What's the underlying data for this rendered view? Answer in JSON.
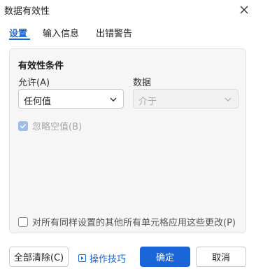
{
  "dialog": {
    "title": "数据有效性"
  },
  "tabs": [
    {
      "label": "设置",
      "active": true
    },
    {
      "label": "输入信息",
      "active": false
    },
    {
      "label": "出错警告",
      "active": false
    }
  ],
  "settings": {
    "section_title": "有效性条件",
    "allow_label": "允许(A)",
    "allow_value": "任何值",
    "data_label": "数据",
    "data_value": "介于",
    "ignore_blank_label": "忽略空值(B)",
    "ignore_blank_checked": true,
    "apply_all_label": "对所有同样设置的其他所有单元格应用这些更改(P)",
    "apply_all_checked": false
  },
  "buttons": {
    "clear_all": "全部清除(C)",
    "tips": "操作技巧",
    "ok": "确定",
    "cancel": "取消"
  },
  "colors": {
    "accent": "#1a66d9",
    "panel_bg": "#f6f6f6",
    "disabled_text": "#aaaaaa"
  }
}
